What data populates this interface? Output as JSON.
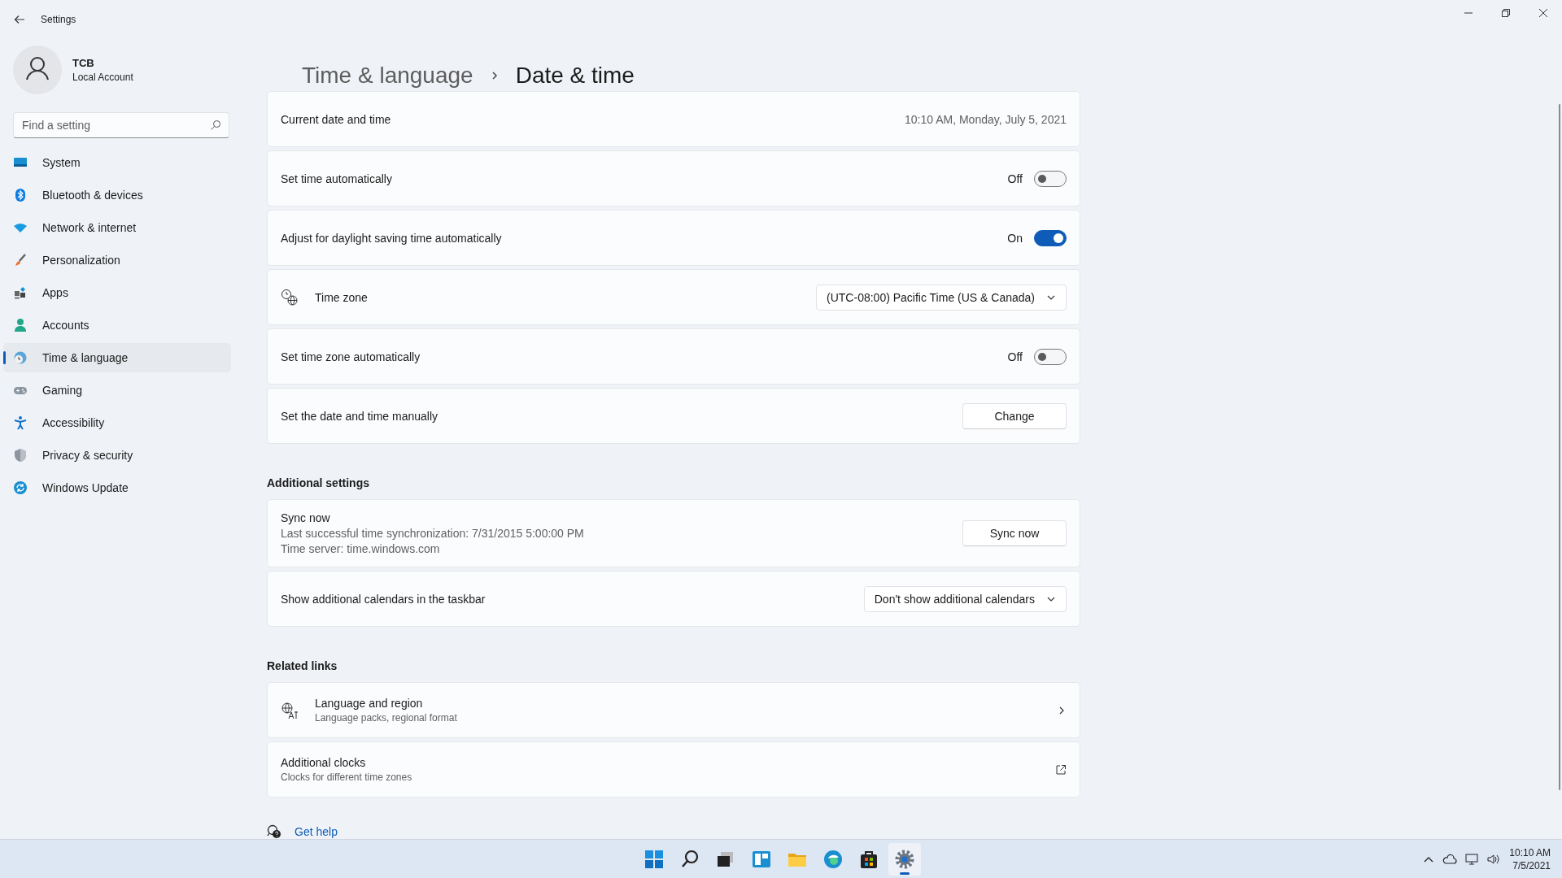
{
  "window": {
    "title": "Settings"
  },
  "account": {
    "name": "TCB",
    "type": "Local Account"
  },
  "search": {
    "placeholder": "Find a setting"
  },
  "nav": [
    {
      "label": "System",
      "selected": false
    },
    {
      "label": "Bluetooth & devices",
      "selected": false
    },
    {
      "label": "Network & internet",
      "selected": false
    },
    {
      "label": "Personalization",
      "selected": false
    },
    {
      "label": "Apps",
      "selected": false
    },
    {
      "label": "Accounts",
      "selected": false
    },
    {
      "label": "Time & language",
      "selected": true
    },
    {
      "label": "Gaming",
      "selected": false
    },
    {
      "label": "Accessibility",
      "selected": false
    },
    {
      "label": "Privacy & security",
      "selected": false
    },
    {
      "label": "Windows Update",
      "selected": false
    }
  ],
  "breadcrumb": {
    "parent": "Time & language",
    "current": "Date & time"
  },
  "settings": [
    {
      "kind": "value",
      "label": "Current date and time",
      "value": "10:10 AM, Monday, July 5, 2021"
    },
    {
      "kind": "toggle",
      "label": "Set time automatically",
      "on": false,
      "state_text": "Off"
    },
    {
      "kind": "toggle",
      "label": "Adjust for daylight saving time automatically",
      "on": true,
      "state_text": "On"
    },
    {
      "kind": "dropdown",
      "label": "Time zone",
      "icon": true,
      "value": "(UTC-08:00) Pacific Time (US & Canada)"
    },
    {
      "kind": "toggle",
      "label": "Set time zone automatically",
      "on": false,
      "state_text": "Off"
    },
    {
      "kind": "button",
      "label": "Set the date and time manually",
      "button": "Change"
    }
  ],
  "additional_settings": {
    "heading": "Additional settings",
    "items": [
      {
        "kind": "button",
        "label": "Sync now",
        "details": [
          "Last successful time synchronization: 7/31/2015 5:00:00 PM",
          "Time server: time.windows.com"
        ],
        "button": "Sync now"
      },
      {
        "kind": "dropdown",
        "label": "Show additional calendars in the taskbar",
        "value": "Don't show additional calendars"
      }
    ]
  },
  "related_links": {
    "heading": "Related links",
    "items": [
      {
        "kind": "chevron",
        "title": "Language and region",
        "subtitle": "Language packs, regional format",
        "icon": true
      },
      {
        "kind": "external",
        "title": "Additional clocks",
        "subtitle": "Clocks for different time zones"
      }
    ]
  },
  "get_help": "Get help",
  "taskbar": {
    "apps": [
      {
        "selected": false
      },
      {
        "selected": false
      },
      {
        "selected": false
      },
      {
        "selected": false
      },
      {
        "selected": false
      },
      {
        "selected": false
      },
      {
        "selected": false
      },
      {
        "selected": true
      }
    ],
    "time": "10:10 AM",
    "date": "7/5/2021"
  }
}
